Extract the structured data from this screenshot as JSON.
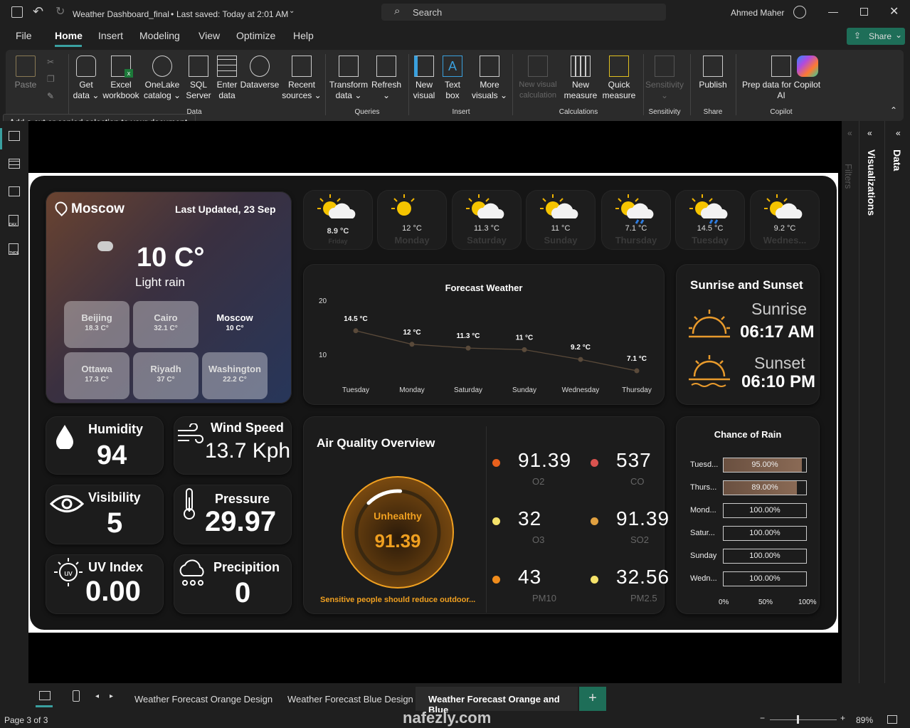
{
  "titlebar": {
    "doc_title": "Weather Dashboard_final",
    "saved": "Last saved: Today at 2:01 AM",
    "search_placeholder": "Search",
    "user": "Ahmed Maher"
  },
  "menu": {
    "items": [
      "File",
      "Home",
      "Insert",
      "Modeling",
      "View",
      "Optimize",
      "Help"
    ],
    "share": "Share"
  },
  "ribbon": {
    "paste": "Paste",
    "clipboard_group": "Clipboard",
    "tooltip": "Add a cut or copied selection to your document.",
    "get_data": "Get data",
    "excel": "Excel workbook",
    "onelake": "OneLake catalog",
    "sql": "SQL Server",
    "enter": "Enter data",
    "dataverse": "Dataverse",
    "recent": "Recent sources",
    "data_group": "Data",
    "transform": "Transform data",
    "refresh": "Refresh",
    "queries_group": "Queries",
    "new_visual": "New visual",
    "text_box": "Text box",
    "more_visuals": "More visuals",
    "insert_group": "Insert",
    "new_visual_calc": "New visual calculation",
    "new_measure": "New measure",
    "quick_measure": "Quick measure",
    "calc_group": "Calculations",
    "sensitivity": "Sensitivity",
    "sensitivity_group": "Sensitivity",
    "publish": "Publish",
    "share_group": "Share",
    "prep": "Prep data for Copilot AI",
    "copilot_group": "Copilot"
  },
  "panes": {
    "filters": "Filters",
    "visualizations": "Visualizations",
    "data": "Data"
  },
  "location": {
    "city": "Moscow",
    "updated": "Last Updated, 23 Sep",
    "temp": "10 C°",
    "condition": "Light rain"
  },
  "cities": [
    {
      "name": "Beijing",
      "temp": "18.3 C°"
    },
    {
      "name": "Cairo",
      "temp": "32.1 C°"
    },
    {
      "name": "Moscow",
      "temp": "10 C°"
    },
    {
      "name": "Ottawa",
      "temp": "17.3 C°"
    },
    {
      "name": "Riyadh",
      "temp": "37 C°"
    },
    {
      "name": "Washington",
      "temp": "22.2 C°"
    }
  ],
  "daily": [
    {
      "temp": "8.9 °C",
      "day": "Friday",
      "icon": "partly-cloudy-icon"
    },
    {
      "temp": "12 °C",
      "day": "Monday",
      "icon": "sun-icon"
    },
    {
      "temp": "11.3 °C",
      "day": "Saturday",
      "icon": "sun-cloud-icon"
    },
    {
      "temp": "11 °C",
      "day": "Sunday",
      "icon": "sun-cloud-icon"
    },
    {
      "temp": "7.1 °C",
      "day": "Thursday",
      "icon": "rain-icon"
    },
    {
      "temp": "14.5 °C",
      "day": "Tuesday",
      "icon": "rain-icon"
    },
    {
      "temp": "9.2 °C",
      "day": "Wednes...",
      "icon": "sun-cloud-icon"
    }
  ],
  "forecast_title": "Forecast Weather",
  "chart_data": {
    "type": "line",
    "title": "Forecast Weather",
    "categories": [
      "Tuesday",
      "Monday",
      "Saturday",
      "Sunday",
      "Wednesday",
      "Thursday"
    ],
    "values": [
      14.5,
      12,
      11.3,
      11,
      9.2,
      7.1
    ],
    "labels": [
      "14.5 °C",
      "12 °C",
      "11.3 °C",
      "11 °C",
      "9.2 °C",
      "7.1 °C"
    ],
    "yticks": [
      "20",
      "10"
    ],
    "ylim": [
      0,
      20
    ]
  },
  "sun": {
    "title": "Sunrise and Sunset",
    "sunrise_label": "Sunrise",
    "sunrise": "06:17 AM",
    "sunset_label": "Sunset",
    "sunset": "06:10 PM"
  },
  "metrics": {
    "humidity_label": "Humidity",
    "humidity": "94",
    "wind_label": "Wind Speed",
    "wind": "13.7 Kph",
    "visibility_label": "Visibility",
    "visibility": "5",
    "pressure_label": "Pressure",
    "pressure": "29.97",
    "uv_label": "UV Index",
    "uv": "0.00",
    "precip_label": "Precipition",
    "precip": "0"
  },
  "air": {
    "title": "Air Quality Overview",
    "status": "Unhealthy",
    "value": "91.39",
    "gauge_fraction": 0.3,
    "note": "Sensitive people should reduce outdoor...",
    "items": [
      {
        "v": "91.39",
        "l": "O2",
        "c": "#e8601c"
      },
      {
        "v": "537",
        "l": "CO",
        "c": "#d9534f"
      },
      {
        "v": "32",
        "l": "O3",
        "c": "#f5e26a"
      },
      {
        "v": "91.39",
        "l": "SO2",
        "c": "#e0a040"
      },
      {
        "v": "43",
        "l": "PM10",
        "c": "#f08c1c"
      },
      {
        "v": "32.56",
        "l": "PM2.5",
        "c": "#f5e26a"
      }
    ]
  },
  "rain": {
    "title": "Chance of Rain",
    "rows": [
      {
        "d": "Tuesd...",
        "v": "95.00%",
        "f": 0.95
      },
      {
        "d": "Thurs...",
        "v": "89.00%",
        "f": 0.89
      },
      {
        "d": "Mond...",
        "v": "100.00%",
        "f": 0
      },
      {
        "d": "Satur...",
        "v": "100.00%",
        "f": 0
      },
      {
        "d": "Sunday",
        "v": "100.00%",
        "f": 0
      },
      {
        "d": "Wedn...",
        "v": "100.00%",
        "f": 0
      }
    ],
    "axis": [
      "0%",
      "50%",
      "100%"
    ]
  },
  "pages": {
    "tabs": [
      "Weather Forecast Orange Design",
      "Weather Forecast Blue Design",
      "Weather Forecast Orange and Blue"
    ],
    "status": "Page 3 of 3",
    "zoom": "89%"
  },
  "watermark": "nafezly.com"
}
